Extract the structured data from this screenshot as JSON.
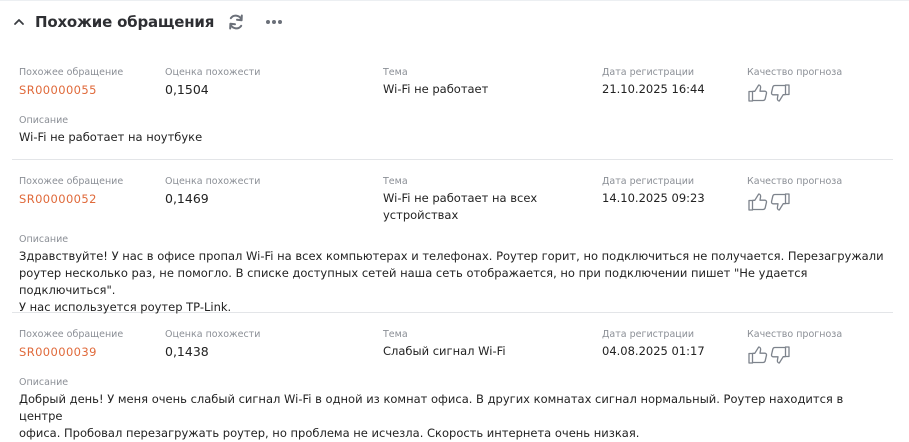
{
  "section": {
    "title": "Похожие обращения"
  },
  "labels": {
    "similar": "Похожее обращение",
    "score": "Оценка похожести",
    "topic": "Тема",
    "date": "Дата регистрации",
    "quality": "Качество прогноза",
    "description": "Описание"
  },
  "cases": [
    {
      "id": "SR00000055",
      "score": "0,1504",
      "topic": "Wi-Fi не работает",
      "date": "21.10.2025 16:44",
      "description": "Wi-Fi не работает на ноутбуке"
    },
    {
      "id": "SR00000052",
      "score": "0,1469",
      "topic": "Wi-Fi не работает на всех\nустройствах",
      "date": "14.10.2025 09:23",
      "description": "Здравствуйте! У нас в офисе пропал Wi-Fi на всех компьютерах и телефонах. Роутер горит, но подключиться не получается. Перезагружали\nроутер несколько раз, не помогло. В списке доступных сетей наша сеть отображается, но при подключении пишет \"Не удается подключиться\".\nУ нас используется роутер TP-Link."
    },
    {
      "id": "SR00000039",
      "score": "0,1438",
      "topic": "Слабый сигнал Wi-Fi",
      "date": "04.08.2025 01:17",
      "description": "Добрый день! У меня очень слабый сигнал Wi-Fi в одной из комнат офиса. В других комнатах сигнал нормальный. Роутер находится в центре\nофиса. Пробовал перезагружать роутер, но проблема не исчезла. Скорость интернета очень низкая."
    }
  ],
  "icons": {
    "collapse": "chevron-up-icon",
    "refresh": "refresh-icon",
    "more": "more-horizontal-icon",
    "like": "thumbs-up-icon",
    "dislike": "thumbs-down-icon"
  },
  "colors": {
    "link": "#e06a3b",
    "label": "#8b8f96",
    "text": "#222222",
    "icon": "#7d838c"
  }
}
